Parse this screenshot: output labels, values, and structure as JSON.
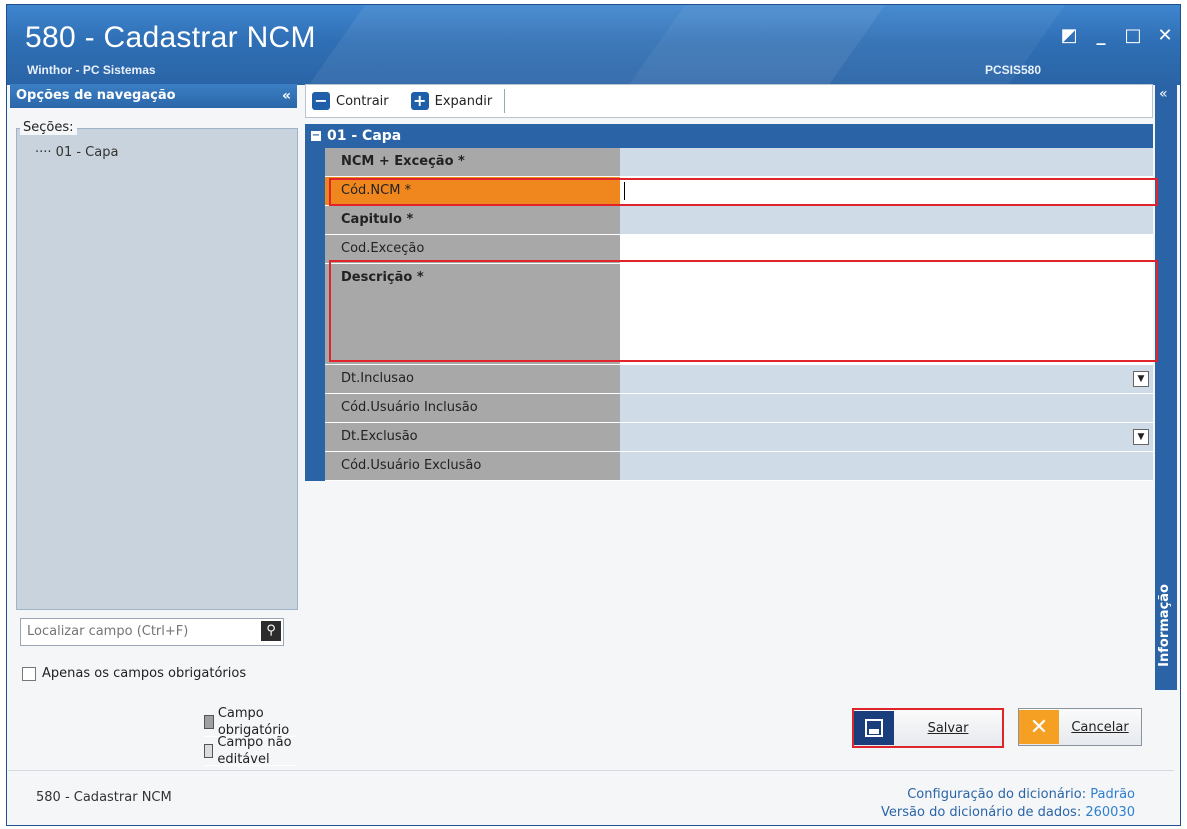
{
  "window": {
    "title": "580 - Cadastrar  NCM",
    "subtitle": "Winthor - PC Sistemas",
    "code": "PCSIS580",
    "controls": [
      "◩",
      "_",
      "□",
      "✕"
    ]
  },
  "nav": {
    "header": "Opções de navegação",
    "collapse": "«",
    "sections_label": "Seções:",
    "tree_items": [
      "01 - Capa"
    ],
    "search_placeholder": "Localizar campo (Ctrl+F)",
    "required_only_label": "Apenas os campos obrigatórios",
    "legend": [
      "Campo obrigatório",
      "Campo não editável"
    ]
  },
  "toolbar": {
    "collapse_label": "Contrair",
    "expand_label": "Expandir"
  },
  "info_panel": {
    "collapse": "«",
    "label": "Informação"
  },
  "form": {
    "section_title": "01 - Capa",
    "fields": [
      {
        "label": "NCM + Exceção *",
        "bold": true,
        "value": ""
      },
      {
        "label": "Cód.NCM *",
        "bold": false,
        "value": ""
      },
      {
        "label": "Capitulo *",
        "bold": true,
        "value": ""
      },
      {
        "label": "Cod.Exceção",
        "bold": false,
        "value": ""
      },
      {
        "label": "Descrição *",
        "bold": true,
        "value": ""
      },
      {
        "label": "Dt.Inclusao",
        "bold": false,
        "value": ""
      },
      {
        "label": "Cód.Usuário Inclusão",
        "bold": false,
        "value": ""
      },
      {
        "label": "Dt.Exclusão",
        "bold": false,
        "value": ""
      },
      {
        "label": "Cód.Usuário Exclusão",
        "bold": false,
        "value": ""
      }
    ]
  },
  "buttons": {
    "save": "Salvar",
    "cancel": "Cancelar"
  },
  "footer": {
    "title": "580 - Cadastrar  NCM",
    "config_label": "Configuração do dicionário:",
    "config_value": "Padrão",
    "version_label": "Versão do dicionário de dados:",
    "version_value": "260030"
  },
  "colors": {
    "accent": "#2a64a6",
    "active_row": "#f0871e",
    "highlight": "#e0242c"
  }
}
